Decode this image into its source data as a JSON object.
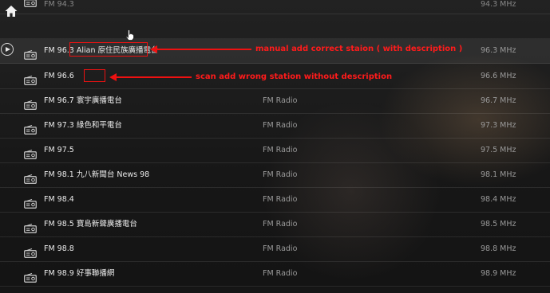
{
  "header": {
    "home_icon": "home-icon"
  },
  "stations": [
    {
      "name": "FM 94.3",
      "type": "",
      "freq": "94.3 MHz"
    },
    {
      "name": "FM 96.3 Alian 原住民族廣播電台",
      "type": "",
      "freq": "96.3 MHz"
    },
    {
      "name": "FM 96.6",
      "type": "",
      "freq": "96.6 MHz"
    },
    {
      "name": "FM 96.7 寰宇廣播電台",
      "type": "FM Radio",
      "freq": "96.7 MHz"
    },
    {
      "name": "FM 97.3 綠色和平電台",
      "type": "FM Radio",
      "freq": "97.3 MHz"
    },
    {
      "name": "FM 97.5",
      "type": "FM Radio",
      "freq": "97.5 MHz"
    },
    {
      "name": "FM 98.1 九八新聞台 News 98",
      "type": "FM Radio",
      "freq": "98.1 MHz"
    },
    {
      "name": "FM 98.4",
      "type": "FM Radio",
      "freq": "98.4 MHz"
    },
    {
      "name": "FM 98.5 寶島新聲廣播電台",
      "type": "FM Radio",
      "freq": "98.5 MHz"
    },
    {
      "name": "FM 98.8",
      "type": "FM Radio",
      "freq": "98.8 MHz"
    },
    {
      "name": "FM 98.9 好事聯播網",
      "type": "FM Radio",
      "freq": "98.9 MHz"
    }
  ],
  "annotations": {
    "manual": "manual add correct staion ( with description )",
    "scan": "scan add wrong station without description",
    "color": "#e11111"
  }
}
